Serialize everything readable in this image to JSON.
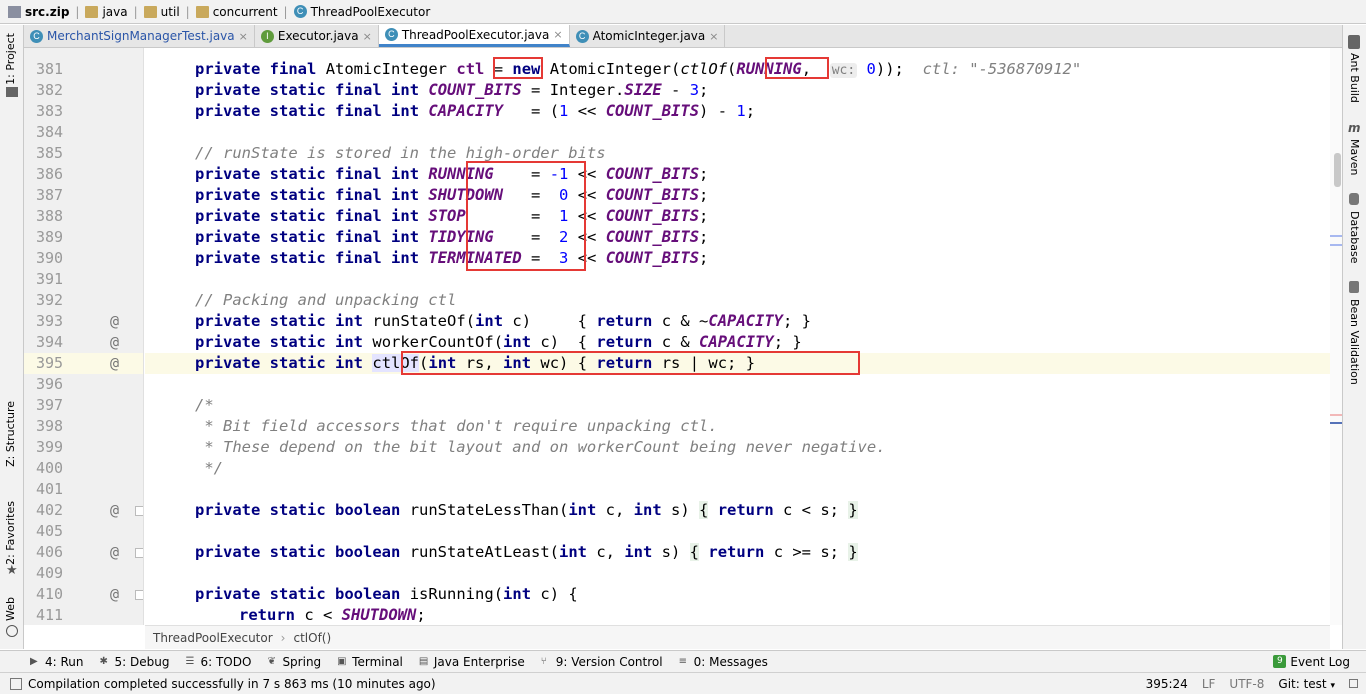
{
  "breadcrumb": {
    "items": [
      "src.zip",
      "java",
      "util",
      "concurrent",
      "ThreadPoolExecutor"
    ]
  },
  "tabs": [
    {
      "label": "MerchantSignManagerTest.java",
      "icon": "C",
      "active": false
    },
    {
      "label": "Executor.java",
      "icon": "I",
      "active": false
    },
    {
      "label": "ThreadPoolExecutor.java",
      "icon": "C",
      "active": true
    },
    {
      "label": "AtomicInteger.java",
      "icon": "C",
      "active": false
    }
  ],
  "left_tools": {
    "project": "1: Project",
    "structure": "Z: Structure",
    "favorites": "2: Favorites",
    "web": "Web"
  },
  "right_tools": {
    "ant": "Ant Build",
    "maven": "Maven",
    "database": "Database",
    "bean": "Bean Validation"
  },
  "code": {
    "line_numbers": [
      "381",
      "382",
      "383",
      "384",
      "385",
      "386",
      "387",
      "388",
      "389",
      "390",
      "391",
      "392",
      "393",
      "394",
      "395",
      "396",
      "397",
      "398",
      "399",
      "400",
      "401",
      "402",
      "405",
      "406",
      "409",
      "410",
      "411"
    ],
    "annot": "@",
    "kw_private": "private",
    "kw_static": "static",
    "kw_final": "final",
    "kw_int": "int",
    "kw_new": "new",
    "kw_return": "return",
    "kw_boolean": "boolean",
    "type_atomic": "AtomicInteger",
    "type_integer": "Integer.",
    "ctl": "ctl",
    "ctlOf": "ctlOf",
    "hint_wc": "wc:",
    "hint_ctl": "ctl: \"-536870912\"",
    "c_RUNNING": "RUNNING",
    "c_SHUTDOWN": "SHUTDOWN",
    "c_STOP": "STOP",
    "c_TIDYING": "TIDYING",
    "c_TERMINATED": "TERMINATED",
    "c_COUNT_BITS": "COUNT_BITS",
    "c_CAPACITY": "CAPACITY",
    "c_SIZE": "SIZE",
    "comment_runstate": "// runState is stored in the high-order bits",
    "comment_packing": "// Packing and unpacking ctl",
    "comment_open": "/*",
    "comment_l1": " * Bit field accessors that don't require unpacking ctl.",
    "comment_l2": " * These depend on the bit layout and on workerCount being never negative.",
    "comment_close": " */",
    "m_runStateOf": "runStateOf",
    "m_workerCountOf": "workerCountOf",
    "m_runStateLessThan": "runStateLessThan",
    "m_runStateAtLeast": "runStateAtLeast",
    "m_isRunning": "isRunning"
  },
  "editor_crumbs": [
    "ThreadPoolExecutor",
    "ctlOf()"
  ],
  "tool_windows": [
    {
      "label": "4: Run",
      "icon": "run-icon"
    },
    {
      "label": "5: Debug",
      "icon": "debug-icon"
    },
    {
      "label": "6: TODO",
      "icon": "todo-icon"
    },
    {
      "label": "Spring",
      "icon": "spring-icon"
    },
    {
      "label": "Terminal",
      "icon": "terminal-icon"
    },
    {
      "label": "Java Enterprise",
      "icon": "java-enterprise-icon"
    },
    {
      "label": "9: Version Control",
      "icon": "version-control-icon"
    },
    {
      "label": "0: Messages",
      "icon": "messages-icon"
    }
  ],
  "event_log": "Event Log",
  "status": {
    "message": "Compilation completed successfully in 7 s 863 ms (10 minutes ago)",
    "position": "395:24",
    "line_sep": "LF",
    "encoding": "UTF-8",
    "vcs": "Git: test"
  },
  "colors": {
    "keyword": "#000080",
    "constant": "#660e7a",
    "number": "#0000ff",
    "comment": "#808080",
    "highlight_box": "#e53935",
    "tab_active": "#4083c9"
  }
}
